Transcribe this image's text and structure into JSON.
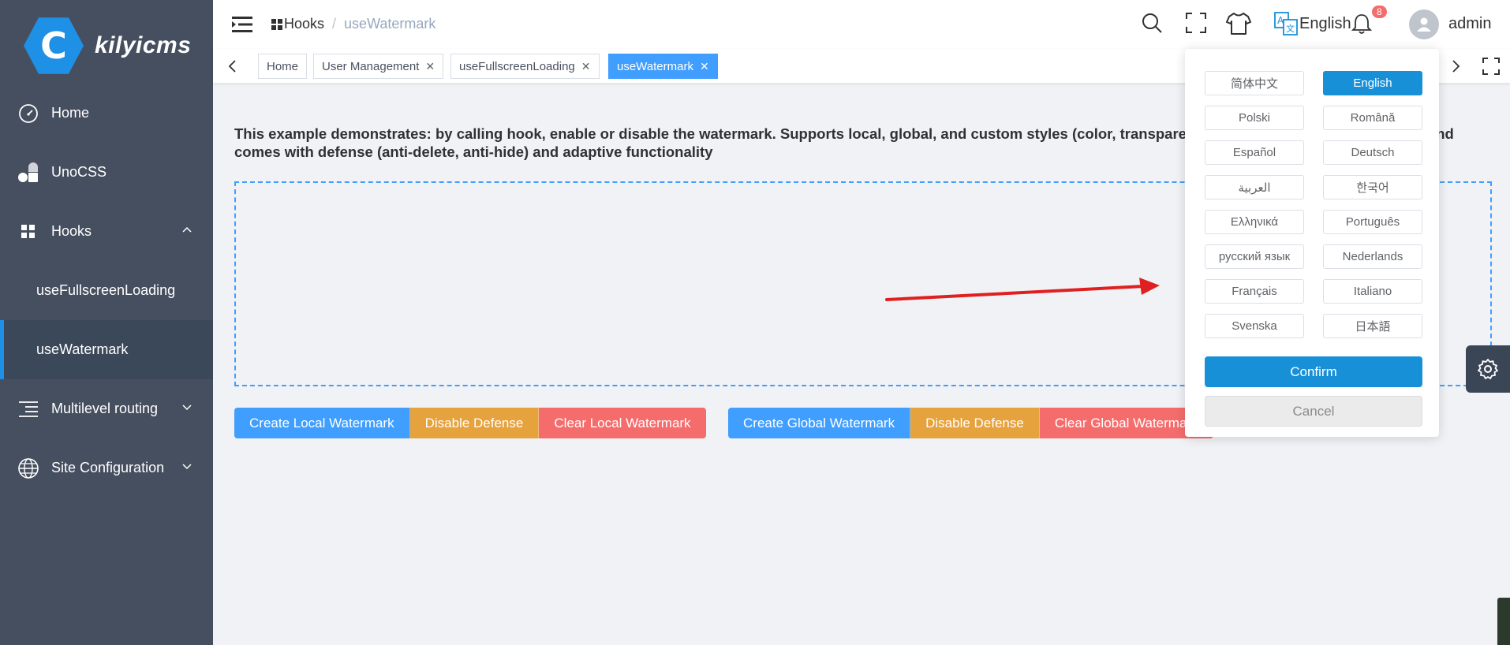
{
  "app": {
    "logo_letter": "C",
    "name": "kilyicms"
  },
  "sidebar": {
    "items": [
      {
        "label": "Home",
        "icon": "dashboard-icon"
      },
      {
        "label": "UnoCSS",
        "icon": "unocss-icon"
      },
      {
        "label": "Hooks",
        "icon": "grid-icon",
        "expanded": true
      },
      {
        "label": "useFullscreenLoading",
        "sub": true
      },
      {
        "label": "useWatermark",
        "sub": true,
        "active": true
      },
      {
        "label": "Multilevel routing",
        "icon": "menu-lines-icon"
      },
      {
        "label": "Site Configuration",
        "icon": "globe-icon"
      }
    ]
  },
  "header": {
    "breadcrumb": [
      "Hooks",
      "useWatermark"
    ],
    "language": "English",
    "notification_count": "8",
    "user": "admin"
  },
  "tabs": [
    {
      "label": "Home",
      "closable": false
    },
    {
      "label": "User Management",
      "closable": true
    },
    {
      "label": "useFullscreenLoading",
      "closable": true
    },
    {
      "label": "useWatermark",
      "closable": true,
      "active": true
    }
  ],
  "content": {
    "description": "This example demonstrates: by calling hook, enable or disable the watermark. Supports local, global, and custom styles (color, transparency, font size, font, tilt angle, etc.), and comes with defense (anti-delete, anti-hide) and adaptive functionality",
    "local_buttons": [
      "Create Local Watermark",
      "Disable Defense",
      "Clear Local Watermark"
    ],
    "global_buttons": [
      "Create Global Watermark",
      "Disable Defense",
      "Clear Global Watermark"
    ]
  },
  "language_popup": {
    "options": [
      "简体中文",
      "English",
      "Polski",
      "Română",
      "Español",
      "Deutsch",
      "العربية",
      "한국어",
      "Ελληνικά",
      "Português",
      "русский язык",
      "Nederlands",
      "Français",
      "Italiano",
      "Svenska",
      "日本語"
    ],
    "selected": "English",
    "confirm": "Confirm",
    "cancel": "Cancel"
  },
  "colors": {
    "sidebar_bg": "#464f5f",
    "primary": "#409eff",
    "warning": "#e6a23c",
    "danger": "#f56c6c",
    "annotation_arrow": "#e02020"
  }
}
